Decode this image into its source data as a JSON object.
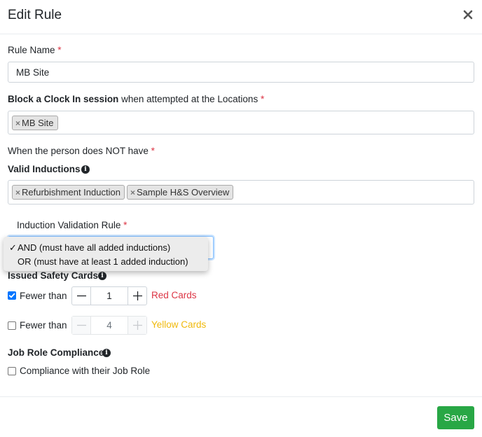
{
  "modal": {
    "title": "Edit Rule"
  },
  "rule_name": {
    "label": "Rule Name",
    "required": "*",
    "value": "MB Site"
  },
  "locations": {
    "label_bold": "Block a Clock In session",
    "label_rest": " when attempted at the Locations ",
    "required": "*",
    "tags": [
      "MB Site"
    ]
  },
  "condition": {
    "label": "When the person does NOT have ",
    "required": "*"
  },
  "inductions": {
    "label": "Valid Inductions",
    "tags": [
      "Refurbishment Induction",
      "Sample H&S Overview"
    ],
    "validation_label": "Induction Validation Rule ",
    "required": "*",
    "options": [
      {
        "label": "AND (must have all added inductions)",
        "selected": true
      },
      {
        "label": "OR (must have at least 1 added induction)",
        "selected": false
      }
    ],
    "checkmark": "✓"
  },
  "safety_cards": {
    "label": "Issued Safety Cards",
    "rows": [
      {
        "checked": true,
        "label": "Fewer than",
        "value": "1",
        "card_label": "Red Cards",
        "color": "#dc3545"
      },
      {
        "checked": false,
        "label": "Fewer than",
        "value": "4",
        "card_label": "Yellow Cards",
        "color": "#f0b90b"
      }
    ]
  },
  "job_role": {
    "label": "Job Role Compliance",
    "checkbox_label": "Compliance with their Job Role",
    "checked": false
  },
  "footer": {
    "save_label": "Save",
    "accent": "#28a745"
  },
  "icons": {
    "close": "close-icon",
    "info": "info-icon",
    "tag_remove": "×"
  }
}
